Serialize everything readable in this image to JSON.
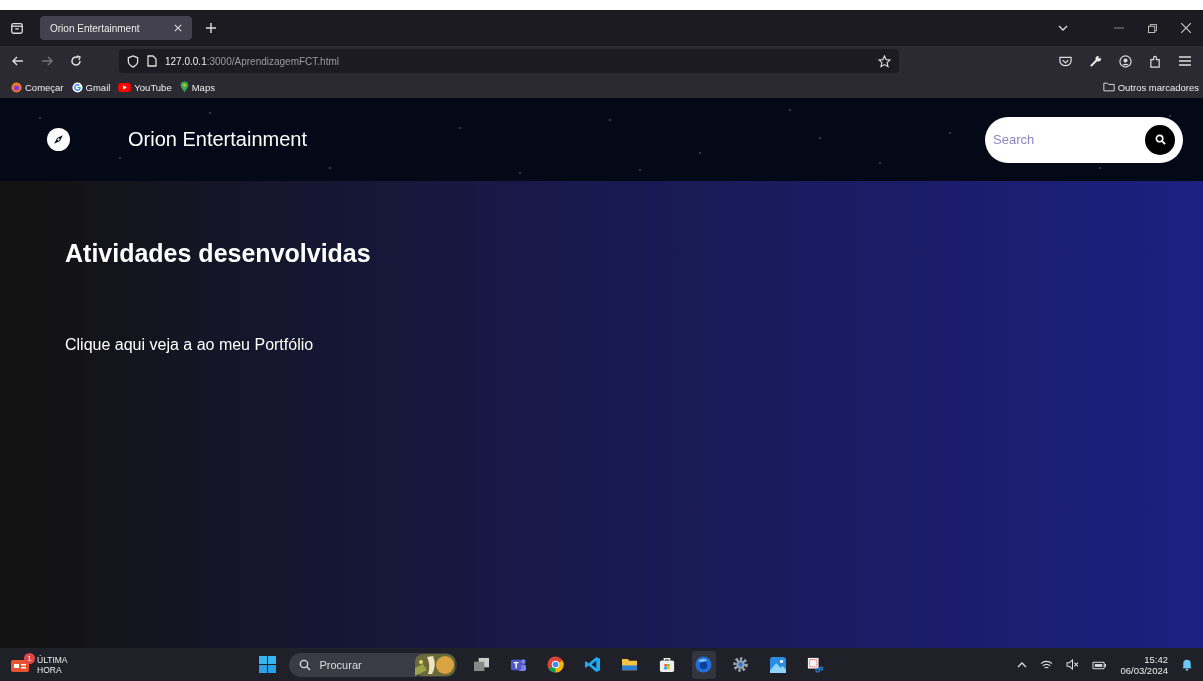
{
  "browser": {
    "tabs": [
      {
        "title": "Orion Entertainment",
        "selected": true
      }
    ],
    "url": {
      "host": "127.0.0.1",
      "path": ":3000/AprendizagemFCT.html"
    },
    "bookmarks": [
      {
        "kind": "firefox",
        "label": "Começar"
      },
      {
        "kind": "google",
        "label": "Gmail"
      },
      {
        "kind": "youtube",
        "label": "YouTube"
      },
      {
        "kind": "maps",
        "label": "Maps"
      }
    ],
    "other_bookmarks": "Outros marcadores"
  },
  "site": {
    "brand": "Orion Entertainment",
    "search": {
      "placeholder": "Search"
    },
    "heading": "Atividades desenvolvidas",
    "link": "Clique aqui veja a ao meu Portfólio"
  },
  "taskbar": {
    "news": {
      "badge": "1",
      "line1": "ÚLTIMA",
      "line2": "HORA"
    },
    "search": {
      "placeholder": "Procurar"
    },
    "apps": [
      {
        "kind": "taskview",
        "selected": false
      },
      {
        "kind": "teams",
        "selected": false
      },
      {
        "kind": "chrome",
        "selected": false
      },
      {
        "kind": "vscode",
        "selected": false
      },
      {
        "kind": "files",
        "selected": false
      },
      {
        "kind": "store",
        "selected": false
      },
      {
        "kind": "firefox",
        "selected": true
      },
      {
        "kind": "settings",
        "selected": false
      },
      {
        "kind": "photos",
        "selected": false
      },
      {
        "kind": "snip",
        "selected": false
      }
    ],
    "time": "15:42",
    "date": "06/03/2024"
  }
}
